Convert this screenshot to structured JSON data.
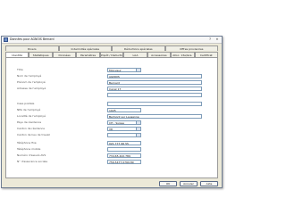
{
  "window": {
    "title": "Données pour AGNOIS Bernard"
  },
  "tabs_back": [
    {
      "label": "Divers"
    },
    {
      "label": "Indemnités spéciales"
    },
    {
      "label": "Déductions spéciales"
    },
    {
      "label": "Offres provisoires"
    }
  ],
  "tabs_front": [
    {
      "label": "Identité"
    },
    {
      "label": "Statistiques"
    },
    {
      "label": "Données"
    },
    {
      "label": "Paramètres"
    },
    {
      "label": "Impôt / Déductions"
    },
    {
      "label": "LAA"
    },
    {
      "label": "Accessoires"
    },
    {
      "label": "Alloc. 13e/Gra."
    },
    {
      "label": "Certificat"
    }
  ],
  "fields": [
    {
      "label": "Titre",
      "value": "Monsieur"
    },
    {
      "label": "Nom de l'employé",
      "value": "AGNOIS"
    },
    {
      "label": "Prénom de l'employé",
      "value": "Bernard"
    },
    {
      "label": "Adresse de l'employé",
      "value": "Canal 17"
    },
    {
      "label": "",
      "value": ""
    },
    {
      "label": "Case postale",
      "value": ""
    },
    {
      "label": "NPA de l'employé",
      "value": "1025"
    },
    {
      "label": "Localité de l'employé",
      "value": "Belmont sur Lausanne"
    },
    {
      "label": "Pays de résidence",
      "value": "CH - Suisse"
    },
    {
      "label": "Canton de résidence",
      "value": "VD"
    },
    {
      "label": "Canton de lieu de travail",
      "value": ""
    },
    {
      "label": "Téléphone fixe",
      "value": "021 777 66 55"
    },
    {
      "label": "Téléphone mobile",
      "value": ""
    },
    {
      "label": "Numéro d'assuré AVS",
      "value": "734.65.422.789"
    },
    {
      "label": "N° d'assurance sociale",
      "value": "756.5477.0769.89"
    }
  ],
  "buttons": {
    "ok": "OK",
    "cancel": "Annuler",
    "help": "Aide"
  }
}
